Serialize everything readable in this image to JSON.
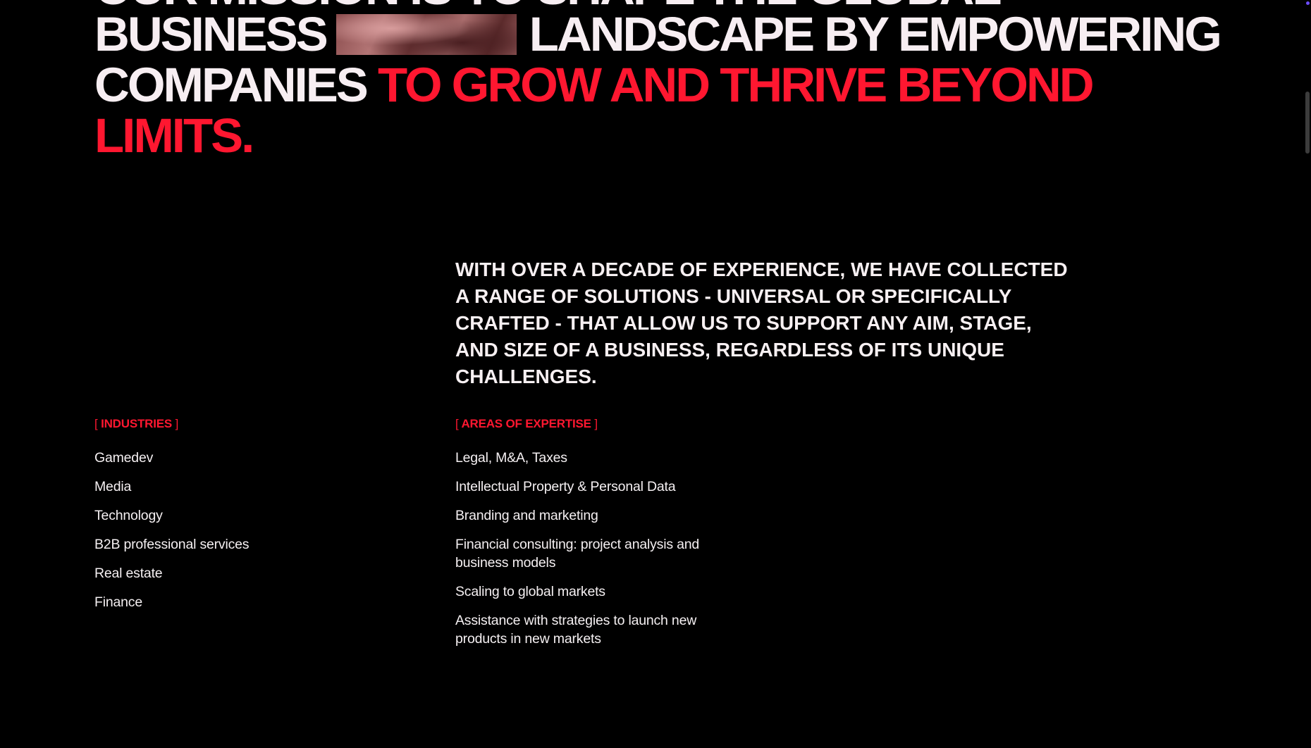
{
  "hero": {
    "line0": {
      "text": "Our mission is to shape the global"
    },
    "line1": {
      "before": "Business",
      "after": "landscape by empowering"
    },
    "line2": {
      "white": "Companies",
      "red": "to grow and thrive beyond"
    },
    "line3": {
      "red": "limits."
    }
  },
  "intro": {
    "text": "With over a decade of experience, we have collected a range of solutions - universal or specifically crafted - that allow us to support any aim, stage, and size of a business, regardless of its unique challenges."
  },
  "industries": {
    "heading": "Industries",
    "items": [
      "Gamedev",
      "Media",
      "Technology",
      "B2B professional services",
      "Real estate",
      "Finance"
    ]
  },
  "expertise": {
    "heading": "Areas of expertise",
    "items": [
      "Legal, M&A, Taxes",
      "Intellectual Property & Personal Data",
      "Branding and marketing",
      "Financial consulting: project analysis and business models",
      "Scaling to global markets",
      "Assistance with strategies to launch new products in new markets"
    ]
  },
  "colors": {
    "background": "#000000",
    "text": "#f7f0f2",
    "accent": "#ff1730"
  }
}
